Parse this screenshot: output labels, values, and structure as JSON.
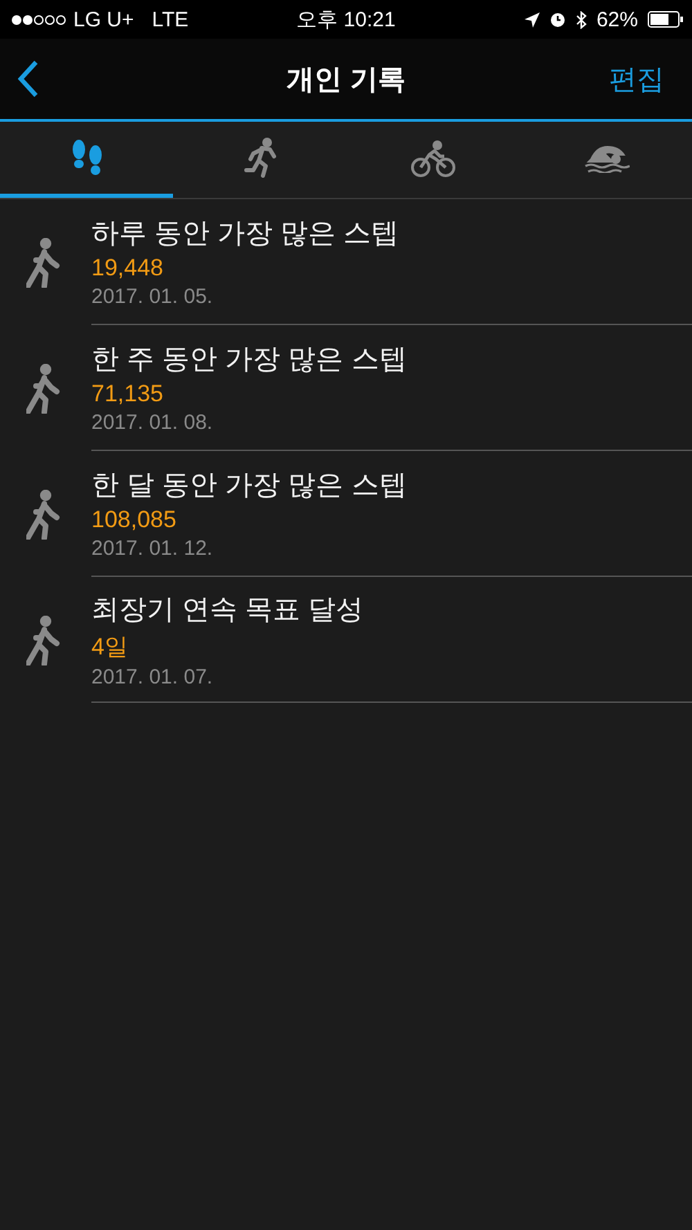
{
  "status_bar": {
    "carrier": "LG U+",
    "network": "LTE",
    "time": "오후 10:21",
    "battery": "62%"
  },
  "nav": {
    "title": "개인 기록",
    "action": "편집"
  },
  "tabs": [
    {
      "kind": "steps",
      "selected": true
    },
    {
      "kind": "run",
      "selected": false
    },
    {
      "kind": "bike",
      "selected": false
    },
    {
      "kind": "swim",
      "selected": false
    }
  ],
  "records": [
    {
      "title": "하루 동안 가장 많은 스텝",
      "value": "19,448",
      "date": "2017. 01. 05."
    },
    {
      "title": "한 주 동안 가장 많은 스텝",
      "value": "71,135",
      "date": "2017. 01. 08."
    },
    {
      "title": "한 달 동안 가장 많은 스텝",
      "value": "108,085",
      "date": "2017. 01. 12."
    },
    {
      "title": "최장기 연속 목표 달성",
      "value": "4일",
      "date": "2017. 01. 07."
    }
  ]
}
